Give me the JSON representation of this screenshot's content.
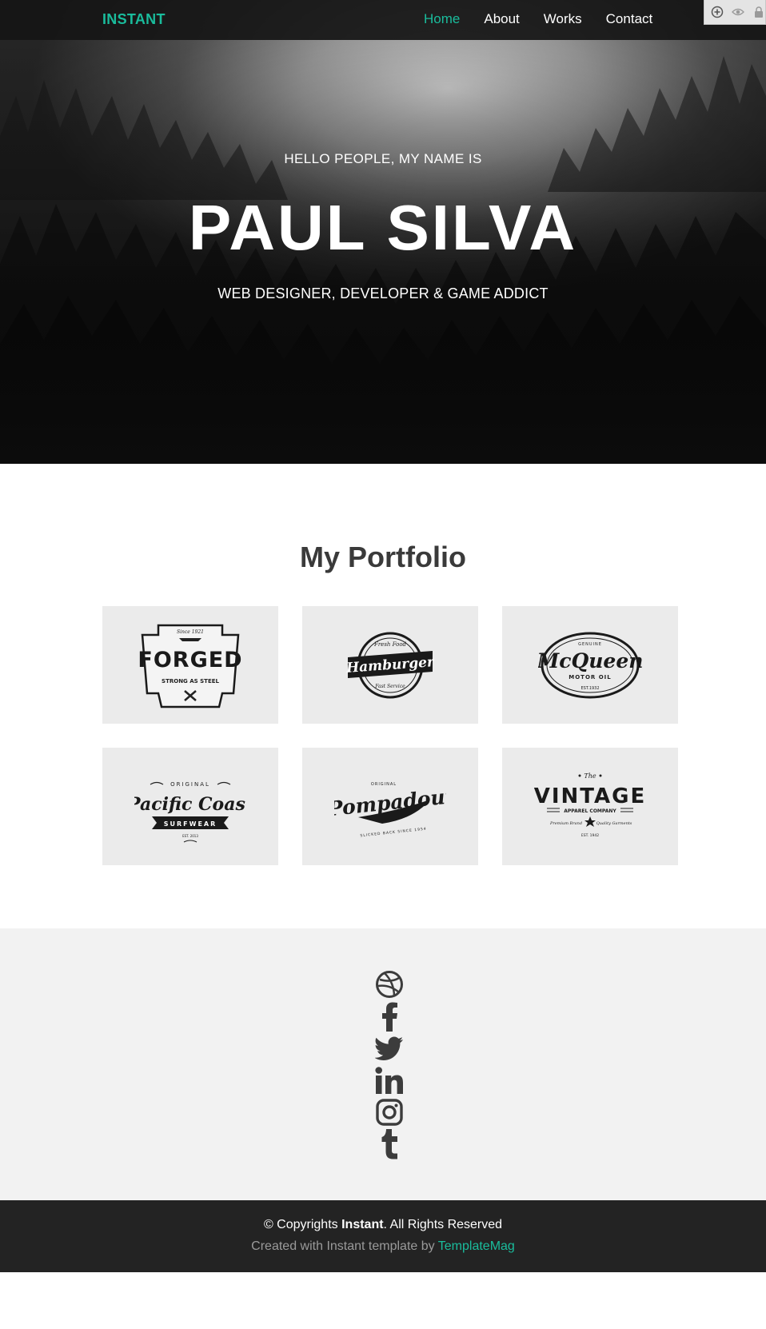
{
  "nav": {
    "brand": "INSTANT",
    "links": [
      {
        "label": "Home",
        "active": true
      },
      {
        "label": "About",
        "active": false
      },
      {
        "label": "Works",
        "active": false
      },
      {
        "label": "Contact",
        "active": false
      }
    ]
  },
  "toolbar": {
    "icons": [
      "zoom-in-icon",
      "eye-icon",
      "lock-icon"
    ]
  },
  "hero": {
    "greeting": "HELLO PEOPLE, MY NAME IS",
    "name": "PAUL SILVA",
    "tagline": "WEB DESIGNER, DEVELOPER & GAME ADDICT"
  },
  "portfolio": {
    "title": "My Portfolio",
    "items": [
      {
        "logo": "FORGED",
        "top": "Since 1921",
        "bottom": "STRONG AS STEEL"
      },
      {
        "logo": "Hamburger",
        "top": "Fresh Food",
        "bottom": "Fast Service"
      },
      {
        "logo": "McQueen",
        "top": "GENUINE",
        "bottom": "MOTOR OIL",
        "est": "EST.1932"
      },
      {
        "logo": "Pacific Coast",
        "top": "ORIGINAL",
        "bottom": "SURFWEAR",
        "est": "EST. 2013"
      },
      {
        "logo": "Pompadour",
        "top": "ORIGINAL",
        "bottom": "SLICKED BACK SINCE 1954"
      },
      {
        "logo": "VINTAGE",
        "top": "The",
        "bottom": "APPAREL COMPANY",
        "left": "Premium Brand",
        "right": "Quality Garments",
        "est": "EST. 1942"
      }
    ]
  },
  "social": {
    "icons": [
      "dribbble-icon",
      "facebook-icon",
      "twitter-icon",
      "linkedin-icon",
      "instagram-icon",
      "tumblr-icon"
    ]
  },
  "footer": {
    "copy_prefix": "© Copyrights ",
    "copy_brand": "Instant",
    "copy_suffix": ". All Rights Reserved",
    "credit_prefix": "Created with Instant template by ",
    "credit_link": "TemplateMag"
  },
  "colors": {
    "accent": "#1abc9c",
    "footer_bg": "#232323",
    "tile_bg": "#ebebeb",
    "social_bg": "#f2f2f2"
  }
}
